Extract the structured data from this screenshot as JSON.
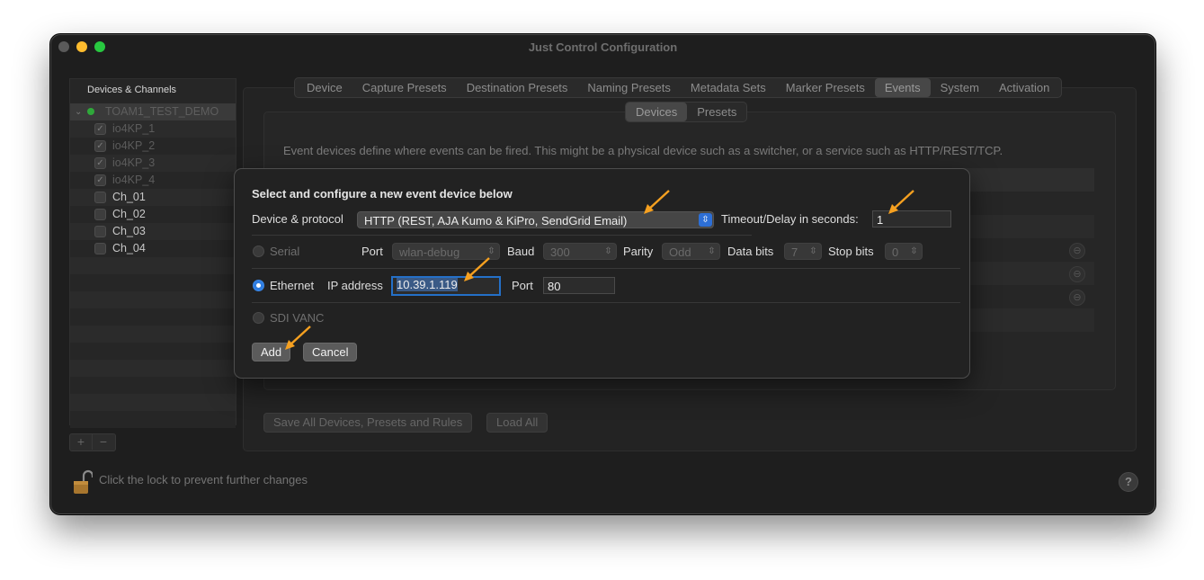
{
  "window": {
    "title": "Just Control Configuration"
  },
  "sidebar": {
    "header": "Devices & Channels",
    "device": {
      "name": "TOAM1_TEST_DEMO",
      "status_color": "#2fa83a"
    },
    "channels": [
      {
        "label": "io4KP_1",
        "checked": true
      },
      {
        "label": "io4KP_2",
        "checked": true
      },
      {
        "label": "io4KP_3",
        "checked": true
      },
      {
        "label": "io4KP_4",
        "checked": true
      },
      {
        "label": "Ch_01",
        "checked": false
      },
      {
        "label": "Ch_02",
        "checked": false
      },
      {
        "label": "Ch_03",
        "checked": false
      },
      {
        "label": "Ch_04",
        "checked": false
      }
    ],
    "add_label": "+",
    "remove_label": "−"
  },
  "tabs": [
    "Device",
    "Capture Presets",
    "Destination Presets",
    "Naming Presets",
    "Metadata Sets",
    "Marker Presets",
    "Events",
    "System",
    "Activation"
  ],
  "active_tab": "Events",
  "subtabs": [
    "Devices",
    "Presets"
  ],
  "active_subtab": "Devices",
  "description": "Event devices define where events can be fired. This might be a physical device such as a switcher, or a service such as HTTP/REST/TCP.",
  "bottom": {
    "save_label": "Save All Devices, Presets and Rules",
    "load_label": "Load All",
    "lock_text": "Click the lock to prevent further changes",
    "help_label": "?"
  },
  "sheet": {
    "title": "Select and configure a new event device below",
    "protocol_label": "Device & protocol",
    "protocol_value": "HTTP (REST, AJA Kumo & KiPro, SendGrid Email)",
    "timeout_label": "Timeout/Delay in seconds:",
    "timeout_value": "1",
    "serial": {
      "label": "Serial",
      "port_label": "Port",
      "port_value": "wlan-debug",
      "baud_label": "Baud",
      "baud_value": "300",
      "parity_label": "Parity",
      "parity_value": "Odd",
      "databits_label": "Data bits",
      "databits_value": "7",
      "stopbits_label": "Stop bits",
      "stopbits_value": "0"
    },
    "ethernet": {
      "label": "Ethernet",
      "ip_label": "IP address",
      "ip_value": "10.39.1.119",
      "port_label": "Port",
      "port_value": "80"
    },
    "sdi": {
      "label": "SDI VANC"
    },
    "selected_mode": "Ethernet",
    "add_label": "Add",
    "cancel_label": "Cancel"
  },
  "annotation_color": "#f5a020"
}
